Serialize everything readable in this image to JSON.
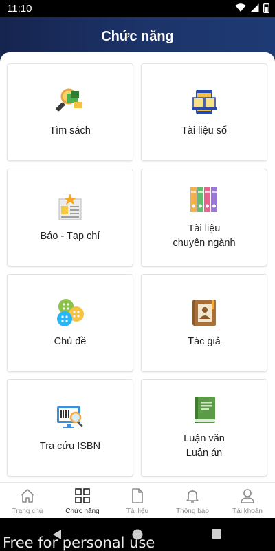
{
  "status_bar": {
    "time": "11:10"
  },
  "header": {
    "title": "Chức năng"
  },
  "features": [
    {
      "label": "Tìm sách",
      "icon": "search-book-icon"
    },
    {
      "label": "Tài liệu số",
      "icon": "digital-document-icon"
    },
    {
      "label": "Báo - Tạp chí",
      "icon": "newspaper-icon"
    },
    {
      "label": "Tài liệu\nchuyên ngành",
      "icon": "binders-icon"
    },
    {
      "label": "Chủ đề",
      "icon": "buttons-icon"
    },
    {
      "label": "Tác giả",
      "icon": "author-book-icon"
    },
    {
      "label": "Tra cứu ISBN",
      "icon": "isbn-search-icon"
    },
    {
      "label": "Luận văn\nLuận án",
      "icon": "thesis-book-icon"
    }
  ],
  "bottom_nav": [
    {
      "label": "Trang chủ",
      "icon": "home-icon"
    },
    {
      "label": "Chức năng",
      "icon": "grid-icon",
      "active": true
    },
    {
      "label": "Tài liệu",
      "icon": "document-icon"
    },
    {
      "label": "Thông báo",
      "icon": "bell-icon"
    },
    {
      "label": "Tài khoản",
      "icon": "user-icon"
    }
  ],
  "watermark": "Free for personal use",
  "colors": {
    "header": "#1c3368",
    "nav_active": "#222222",
    "nav_inactive": "#8a8a8a"
  }
}
